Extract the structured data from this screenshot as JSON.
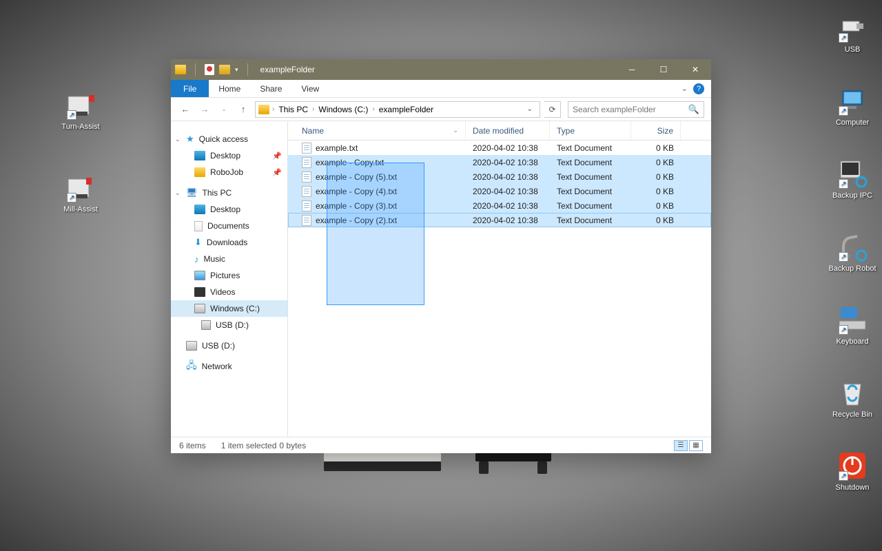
{
  "desktop": {
    "left_icons": [
      {
        "label": "Turn-Assist"
      },
      {
        "label": "Mill-Assist"
      }
    ],
    "right_icons": [
      {
        "label": "USB"
      },
      {
        "label": "Computer"
      },
      {
        "label": "Backup IPC"
      },
      {
        "label": "Backup Robot"
      },
      {
        "label": "Keyboard"
      },
      {
        "label": "Recycle Bin"
      },
      {
        "label": "Shutdown"
      }
    ]
  },
  "window": {
    "title": "exampleFolder",
    "tabs": {
      "file": "File",
      "home": "Home",
      "share": "Share",
      "view": "View"
    },
    "breadcrumbs": [
      "This PC",
      "Windows (C:)",
      "exampleFolder"
    ],
    "search_placeholder": "Search exampleFolder",
    "sidebar": {
      "quick_access": "Quick access",
      "qa_items": [
        {
          "label": "Desktop",
          "pinned": true
        },
        {
          "label": "RoboJob",
          "pinned": true
        }
      ],
      "this_pc": "This PC",
      "pc_items": [
        {
          "label": "Desktop"
        },
        {
          "label": "Documents"
        },
        {
          "label": "Downloads"
        },
        {
          "label": "Music"
        },
        {
          "label": "Pictures"
        },
        {
          "label": "Videos"
        },
        {
          "label": "Windows (C:)",
          "selected": true
        },
        {
          "label": "USB (D:)"
        }
      ],
      "extra_drive": {
        "label": "USB (D:)"
      },
      "network": "Network"
    },
    "columns": {
      "name": "Name",
      "date": "Date modified",
      "type": "Type",
      "size": "Size"
    },
    "files": [
      {
        "name": "example.txt",
        "date": "2020-04-02 10:38",
        "type": "Text Document",
        "size": "0 KB",
        "selected": false
      },
      {
        "name": "example - Copy.txt",
        "date": "2020-04-02 10:38",
        "type": "Text Document",
        "size": "0 KB",
        "selected": true
      },
      {
        "name": "example - Copy (5).txt",
        "date": "2020-04-02 10:38",
        "type": "Text Document",
        "size": "0 KB",
        "selected": true
      },
      {
        "name": "example - Copy (4).txt",
        "date": "2020-04-02 10:38",
        "type": "Text Document",
        "size": "0 KB",
        "selected": true
      },
      {
        "name": "example - Copy (3).txt",
        "date": "2020-04-02 10:38",
        "type": "Text Document",
        "size": "0 KB",
        "selected": true
      },
      {
        "name": "example - Copy (2).txt",
        "date": "2020-04-02 10:38",
        "type": "Text Document",
        "size": "0 KB",
        "selected": true
      }
    ],
    "status": {
      "items": "6 items",
      "selected": "1 item selected",
      "size": "0 bytes"
    }
  }
}
